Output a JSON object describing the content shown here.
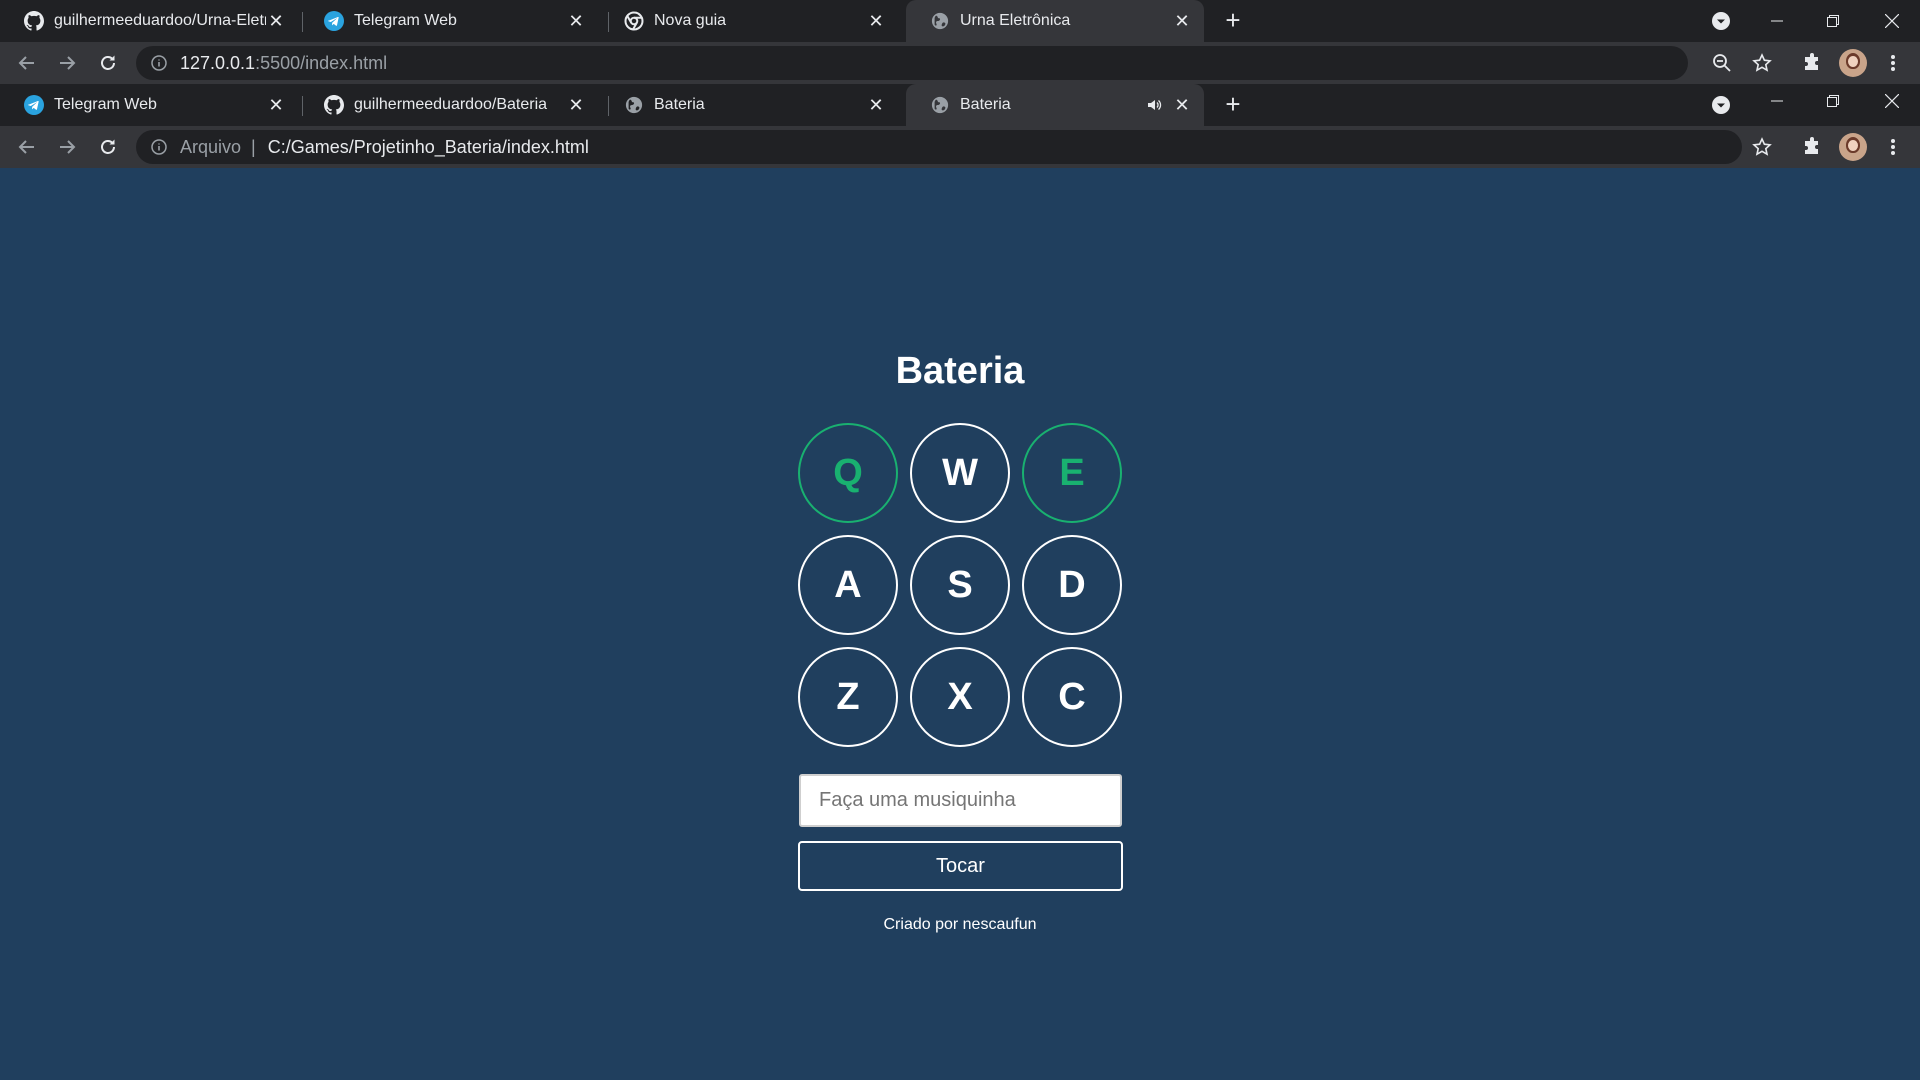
{
  "outer_window": {
    "tabs": [
      {
        "title": "guilhermeeduardoo/Urna-Eletron",
        "icon": "github-icon",
        "active": false
      },
      {
        "title": "Telegram Web",
        "icon": "telegram-icon",
        "active": false
      },
      {
        "title": "Nova guia",
        "icon": "chrome-icon",
        "active": false
      },
      {
        "title": "Urna Eletrônica",
        "icon": "globe-icon",
        "active": true
      }
    ],
    "url_host": "127.0.0.1",
    "url_path": ":5500/index.html"
  },
  "inner_window": {
    "tabs": [
      {
        "title": "Telegram Web",
        "icon": "telegram-icon",
        "active": false
      },
      {
        "title": "guilhermeeduardoo/Bateria",
        "icon": "github-icon",
        "active": false
      },
      {
        "title": "Bateria",
        "icon": "globe-icon",
        "active": false
      },
      {
        "title": "Bateria",
        "icon": "globe-icon",
        "active": true,
        "audio": true
      }
    ],
    "scheme_label": "Arquivo",
    "scheme_sep": "|",
    "url": "C:/Games/Projetinho_Bateria/index.html"
  },
  "page": {
    "title": "Bateria",
    "keys": [
      {
        "label": "Q",
        "active": true
      },
      {
        "label": "W",
        "active": false
      },
      {
        "label": "E",
        "active": true
      },
      {
        "label": "A",
        "active": false
      },
      {
        "label": "S",
        "active": false
      },
      {
        "label": "D",
        "active": false
      },
      {
        "label": "Z",
        "active": false
      },
      {
        "label": "X",
        "active": false
      },
      {
        "label": "C",
        "active": false
      }
    ],
    "input_placeholder": "Faça uma musiquinha",
    "input_value": "",
    "play_label": "Tocar",
    "footer": "Criado por nescaufun"
  },
  "colors": {
    "background": "#203f5e",
    "active_key": "#19b170",
    "tab_strip": "#202124",
    "toolbar": "#35363a"
  }
}
